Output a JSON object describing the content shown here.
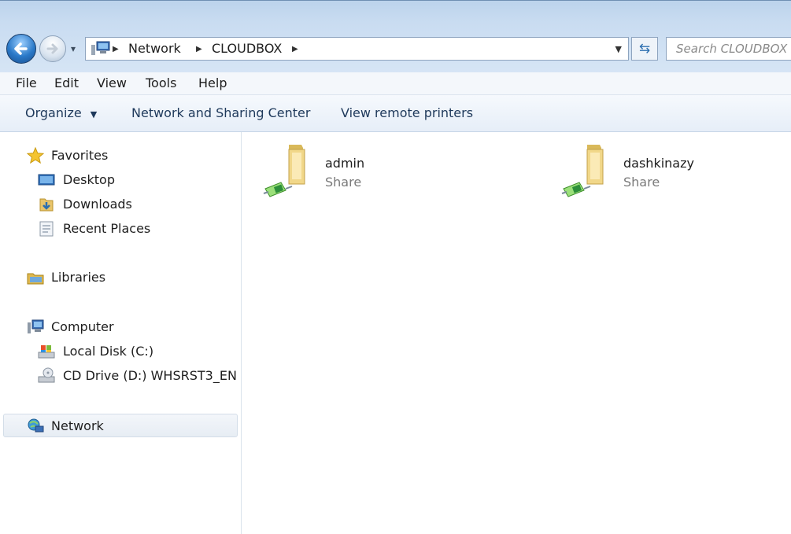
{
  "address": {
    "crumbs": [
      "Network",
      "CLOUDBOX"
    ],
    "search_placeholder": "Search CLOUDBOX"
  },
  "menu": [
    "File",
    "Edit",
    "View",
    "Tools",
    "Help"
  ],
  "toolbar": {
    "organize": "Organize",
    "network_sharing": "Network and Sharing Center",
    "remote_printers": "View remote printers"
  },
  "sidebar": {
    "favorites": "Favorites",
    "desktop": "Desktop",
    "downloads": "Downloads",
    "recent_places": "Recent Places",
    "libraries": "Libraries",
    "computer": "Computer",
    "local_disk": "Local Disk (C:)",
    "cd_drive": "CD Drive (D:) WHSRST3_EN",
    "network": "Network"
  },
  "shares": [
    {
      "name": "admin",
      "type": "Share",
      "icon": "shared-folder-icon"
    },
    {
      "name": "dashkinazy",
      "type": "Share",
      "icon": "shared-folder-icon"
    }
  ],
  "colors": {
    "titlebar": "#c9dcf1",
    "command_text": "#1e395b",
    "accent": "#2a79c8"
  }
}
